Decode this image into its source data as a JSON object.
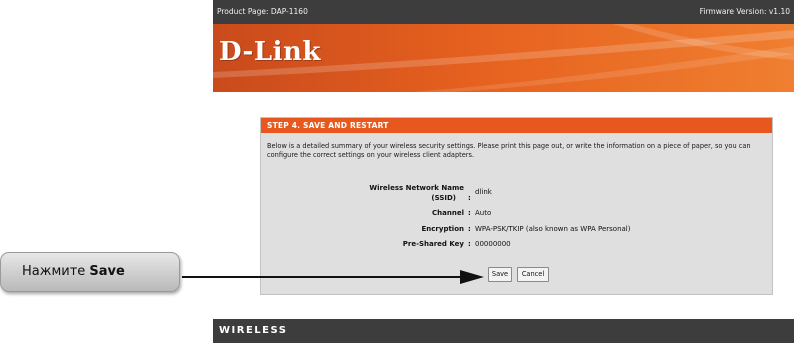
{
  "topbar": {
    "product": "Product Page: DAP-1160",
    "firmware": "Firmware Version: v1.10"
  },
  "brand": {
    "logo": "D-Link"
  },
  "panel": {
    "title": "STEP 4. SAVE AND RESTART",
    "intro": "Below is a detailed summary of your wireless security settings. Please print this page out, or write the information on a piece of paper, so you can configure the correct settings on your wireless client adapters.",
    "rows": [
      {
        "label": "Wireless Network Name",
        "label2": "(SSID)",
        "value": "dlink"
      },
      {
        "label": "Channel",
        "value": "Auto"
      },
      {
        "label": "Encryption",
        "value": "WPA-PSK/TKIP (also known as WPA Personal)"
      },
      {
        "label": "Pre-Shared Key",
        "value": "00000000"
      }
    ],
    "colon": ":",
    "save_label": "Save",
    "cancel_label": "Cancel"
  },
  "footer": {
    "label": "WIRELESS"
  },
  "callout": {
    "prefix": "Нажмите ",
    "action": "Save"
  },
  "colors": {
    "accent": "#e8581e",
    "header_bg": "#3d3d3d",
    "panel_bg": "#dfdfdf"
  }
}
